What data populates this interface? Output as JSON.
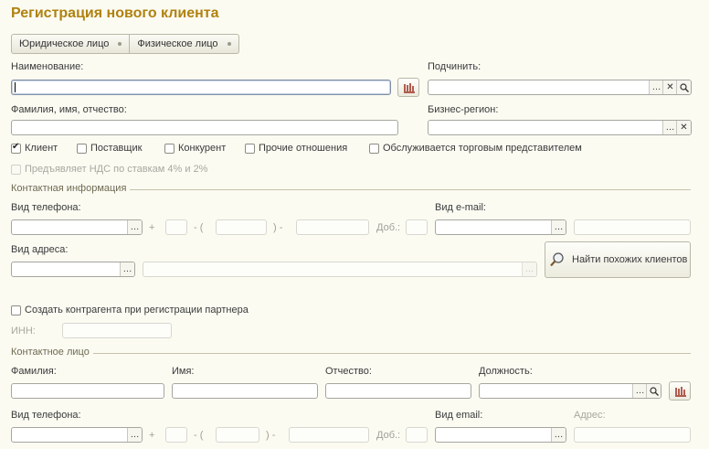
{
  "title": "Регистрация нового клиента",
  "type_switch": [
    "Юридическое лицо",
    "Физическое лицо"
  ],
  "labels": {
    "name": "Наименование:",
    "subordinate": "Подчинить:",
    "fio": "Фамилия, имя, отчество:",
    "business_region": "Бизнес-регион:"
  },
  "checkboxes": {
    "client": "Клиент",
    "supplier": "Поставщик",
    "competitor": "Конкурент",
    "other": "Прочие отношения",
    "served": "Обслуживается торговым представителем",
    "vat": "Предъявляет НДС по ставкам 4% и 2%",
    "create_counterparty": "Создать контрагента при регистрации партнера"
  },
  "contact_info": {
    "header": "Контактная информация",
    "phone_type": "Вид телефона:",
    "email_type": "Вид e-mail:",
    "address_type": "Вид адреса:",
    "plus": "+",
    "dash_open": "- (",
    "close_dash": ") -",
    "ext": "Доб.:",
    "find_similar": "Найти похожих клиентов"
  },
  "inn": "ИНН:",
  "contact_person": {
    "header": "Контактное лицо",
    "last_name": "Фамилия:",
    "first_name": "Имя:",
    "middle_name": "Отчество:",
    "position": "Должность:",
    "phone_type": "Вид телефона:",
    "email_type": "Вид email:",
    "address": "Адрес:",
    "plus": "+",
    "dash_open": "- (",
    "close_dash": ") -",
    "ext": "Доб.:"
  },
  "icons": {
    "ellipsis": "…",
    "clear": "✕",
    "search": "magnifier-icon",
    "bars": "bar-chart-icon"
  },
  "colors": {
    "title": "#b0820e",
    "background": "#fbfbf2"
  }
}
